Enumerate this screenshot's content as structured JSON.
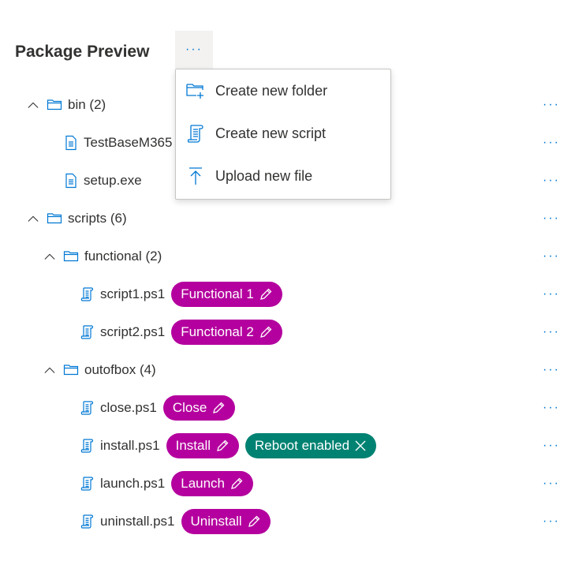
{
  "header": {
    "title": "Package Preview",
    "more_label": "···"
  },
  "menu": {
    "items": [
      {
        "label": "Create new folder",
        "icon": "folder-add-icon"
      },
      {
        "label": "Create new script",
        "icon": "script-icon"
      },
      {
        "label": "Upload new file",
        "icon": "upload-icon"
      }
    ]
  },
  "colors": {
    "accent": "#0078d4",
    "tag": "#b4009e",
    "reboot": "#008272"
  },
  "tree": [
    {
      "type": "folder",
      "level": 0,
      "label": "bin (2)",
      "tags": []
    },
    {
      "type": "file",
      "level": 1,
      "label": "TestBaseM365",
      "tags": []
    },
    {
      "type": "file",
      "level": 1,
      "label": "setup.exe",
      "tags": []
    },
    {
      "type": "folder",
      "level": 0,
      "label": "scripts (6)",
      "tags": []
    },
    {
      "type": "folder",
      "level": 1,
      "label": "functional (2)",
      "tags": []
    },
    {
      "type": "script",
      "level": 2,
      "label": "script1.ps1",
      "tags": [
        {
          "label": "Functional 1",
          "kind": "edit"
        }
      ]
    },
    {
      "type": "script",
      "level": 2,
      "label": "script2.ps1",
      "tags": [
        {
          "label": "Functional 2",
          "kind": "edit"
        }
      ]
    },
    {
      "type": "folder",
      "level": 1,
      "label": "outofbox (4)",
      "tags": []
    },
    {
      "type": "script",
      "level": 2,
      "label": "close.ps1",
      "tags": [
        {
          "label": "Close",
          "kind": "edit"
        }
      ]
    },
    {
      "type": "script",
      "level": 2,
      "label": "install.ps1",
      "tags": [
        {
          "label": "Install",
          "kind": "edit"
        },
        {
          "label": "Reboot enabled",
          "kind": "remove"
        }
      ]
    },
    {
      "type": "script",
      "level": 2,
      "label": "launch.ps1",
      "tags": [
        {
          "label": "Launch",
          "kind": "edit"
        }
      ]
    },
    {
      "type": "script",
      "level": 2,
      "label": "uninstall.ps1",
      "tags": [
        {
          "label": "Uninstall",
          "kind": "edit"
        }
      ]
    }
  ],
  "row_more_label": "···"
}
